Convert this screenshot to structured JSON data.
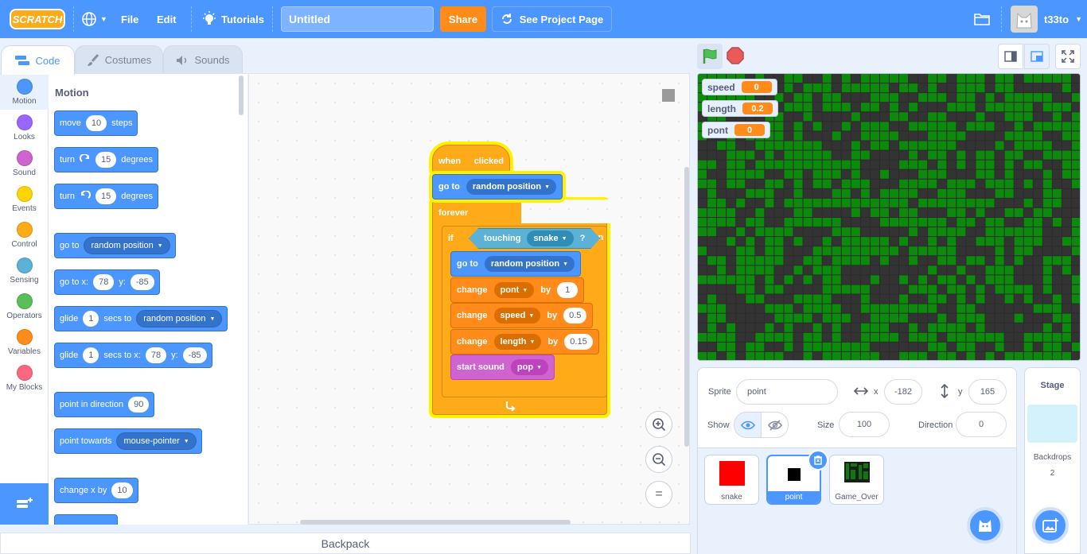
{
  "menubar": {
    "logo": "SCRATCH",
    "file": "File",
    "edit": "Edit",
    "tutorials": "Tutorials",
    "title": "Untitled",
    "share": "Share",
    "see_project": "See Project Page",
    "username": "t33to"
  },
  "tabs": {
    "code": "Code",
    "costumes": "Costumes",
    "sounds": "Sounds"
  },
  "categories": [
    {
      "label": "Motion",
      "color": "#4c97ff"
    },
    {
      "label": "Looks",
      "color": "#9966ff"
    },
    {
      "label": "Sound",
      "color": "#cf63cf"
    },
    {
      "label": "Events",
      "color": "#ffd500"
    },
    {
      "label": "Control",
      "color": "#ffab19"
    },
    {
      "label": "Sensing",
      "color": "#5cb1d6"
    },
    {
      "label": "Operators",
      "color": "#59c059"
    },
    {
      "label": "Variables",
      "color": "#ff8c1a"
    },
    {
      "label": "My Blocks",
      "color": "#ff6680"
    }
  ],
  "palette": {
    "heading": "Motion",
    "move": {
      "t1": "move",
      "v": "10",
      "t2": "steps"
    },
    "turn_right": {
      "t1": "turn",
      "v": "15",
      "t2": "degrees"
    },
    "turn_left": {
      "t1": "turn",
      "v": "15",
      "t2": "degrees"
    },
    "goto_random": {
      "t1": "go to",
      "dd": "random position"
    },
    "goto_xy": {
      "t1": "go to x:",
      "x": "78",
      "t2": "y:",
      "y": "-85"
    },
    "glide_random": {
      "t1": "glide",
      "v": "1",
      "t2": "secs to",
      "dd": "random position"
    },
    "glide_xy": {
      "t1": "glide",
      "v": "1",
      "t2": "secs to x:",
      "x": "78",
      "t3": "y:",
      "y": "-85"
    },
    "point_dir": {
      "t1": "point in direction",
      "v": "90"
    },
    "point_towards": {
      "t1": "point towards",
      "dd": "mouse-pointer"
    },
    "change_x": {
      "t1": "change x by",
      "v": "10"
    }
  },
  "script": {
    "hat": {
      "t1": "when",
      "t2": "clicked"
    },
    "goto": {
      "t1": "go to",
      "dd": "random position"
    },
    "forever": "forever",
    "if": {
      "t1": "if",
      "t2": "then"
    },
    "touching": {
      "t1": "touching",
      "dd": "snake",
      "q": "?"
    },
    "goto2": {
      "t1": "go to",
      "dd": "random position"
    },
    "change1": {
      "t1": "change",
      "dd": "pont",
      "t2": "by",
      "v": "1"
    },
    "change2": {
      "t1": "change",
      "dd": "speed",
      "t2": "by",
      "v": "0.5"
    },
    "change3": {
      "t1": "change",
      "dd": "length",
      "t2": "by",
      "v": "0.15"
    },
    "sound": {
      "t1": "start sound",
      "dd": "pop"
    }
  },
  "zoom": {
    "in": "+",
    "out": "−",
    "reset": "="
  },
  "backpack": "Backpack",
  "monitors": [
    {
      "name": "speed",
      "value": "0"
    },
    {
      "name": "length",
      "value": "0.2"
    },
    {
      "name": "pont",
      "value": "0"
    }
  ],
  "sprite_info": {
    "sprite_label": "Sprite",
    "sprite_name": "point",
    "x_label": "x",
    "x": "-182",
    "y_label": "y",
    "y": "165",
    "show_label": "Show",
    "size_label": "Size",
    "size": "100",
    "direction_label": "Direction",
    "direction": "0"
  },
  "sprites": [
    {
      "name": "snake",
      "color": "#ff0000"
    },
    {
      "name": "point",
      "color": "#000000"
    },
    {
      "name": "Game_Over",
      "color": "#0b7a0b"
    }
  ],
  "stage_pane": {
    "title": "Stage",
    "backdrops_label": "Backdrops",
    "backdrops_count": "2"
  },
  "colors": {
    "accent": "#4c97ff",
    "grid_green": "#0b8a0b",
    "grid_dark": "#2b2b2b"
  }
}
